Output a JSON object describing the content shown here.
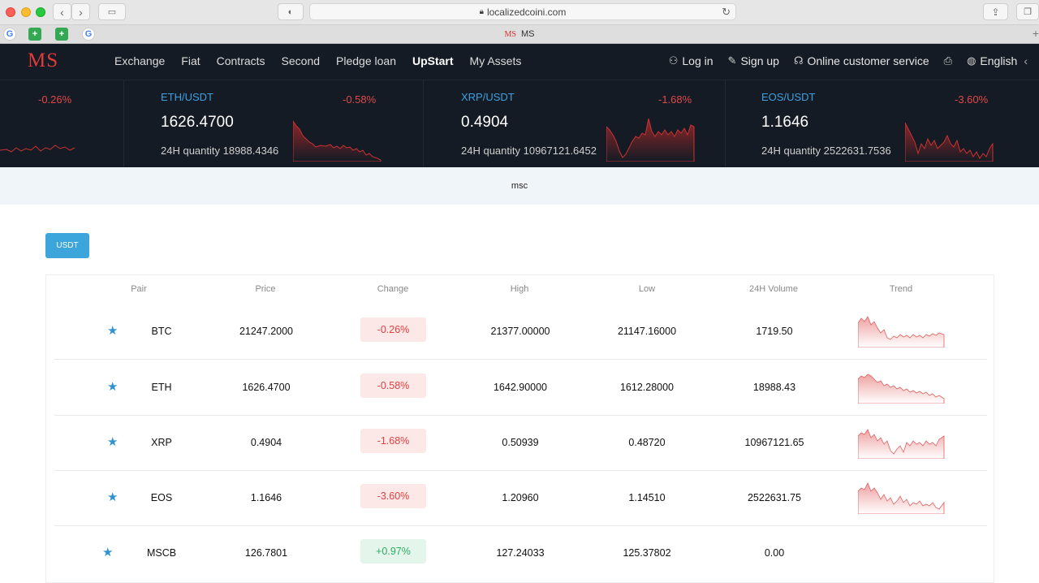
{
  "browser": {
    "url": "localizedcoini.com",
    "tab_title": "MS",
    "tab_logo": "MS"
  },
  "site": {
    "logo": "MS",
    "nav": [
      "Exchange",
      "Fiat",
      "Contracts",
      "Second",
      "Pledge loan",
      "UpStart",
      "My Assets"
    ],
    "active_nav": "UpStart",
    "login": "Log in",
    "signup": "Sign up",
    "support": "Online customer service",
    "language": "English"
  },
  "ticker": [
    {
      "pair": "",
      "change": "-0.26%",
      "price": "",
      "volume": ""
    },
    {
      "pair": "ETH/USDT",
      "change": "-0.58%",
      "price": "1626.4700",
      "volume": "24H quantity 18988.4346"
    },
    {
      "pair": "XRP/USDT",
      "change": "-1.68%",
      "price": "0.4904",
      "volume": "24H quantity 10967121.6452"
    },
    {
      "pair": "EOS/USDT",
      "change": "-3.60%",
      "price": "1.1646",
      "volume": "24H quantity 2522631.7536"
    }
  ],
  "banner": "msc",
  "quote_tab": "USDT",
  "table": {
    "headers": [
      "Pair",
      "Price",
      "Change",
      "High",
      "Low",
      "24H Volume",
      "Trend"
    ],
    "rows": [
      {
        "pair": "BTC",
        "price": "21247.2000",
        "change": "-0.26%",
        "dir": "neg",
        "high": "21377.00000",
        "low": "21147.16000",
        "volume": "1719.50"
      },
      {
        "pair": "ETH",
        "price": "1626.4700",
        "change": "-0.58%",
        "dir": "neg",
        "high": "1642.90000",
        "low": "1612.28000",
        "volume": "18988.43"
      },
      {
        "pair": "XRP",
        "price": "0.4904",
        "change": "-1.68%",
        "dir": "neg",
        "high": "0.50939",
        "low": "0.48720",
        "volume": "10967121.65"
      },
      {
        "pair": "EOS",
        "price": "1.1646",
        "change": "-3.60%",
        "dir": "neg",
        "high": "1.20960",
        "low": "1.14510",
        "volume": "2522631.75"
      },
      {
        "pair": "MSCB",
        "price": "126.7801",
        "change": "+0.97%",
        "dir": "pos",
        "high": "127.24033",
        "low": "125.37802",
        "volume": "0.00"
      }
    ]
  }
}
